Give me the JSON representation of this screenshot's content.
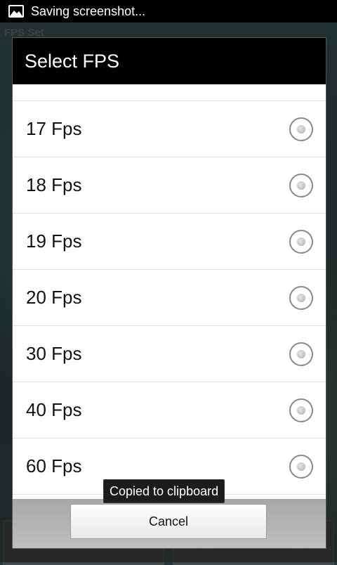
{
  "status_bar": {
    "text": "Saving screenshot...",
    "icon": "image-icon"
  },
  "background_app": {
    "title": "FPS Set"
  },
  "dialog": {
    "title": "Select FPS",
    "options": [
      {
        "label": "17 Fps",
        "selected": false
      },
      {
        "label": "18 Fps",
        "selected": false
      },
      {
        "label": "19 Fps",
        "selected": false
      },
      {
        "label": "20 Fps",
        "selected": false
      },
      {
        "label": "30 Fps",
        "selected": false
      },
      {
        "label": "40 Fps",
        "selected": false
      },
      {
        "label": "60 Fps",
        "selected": false
      }
    ],
    "cancel_label": "Cancel"
  },
  "toast": {
    "text": "Copied to clipboard"
  }
}
